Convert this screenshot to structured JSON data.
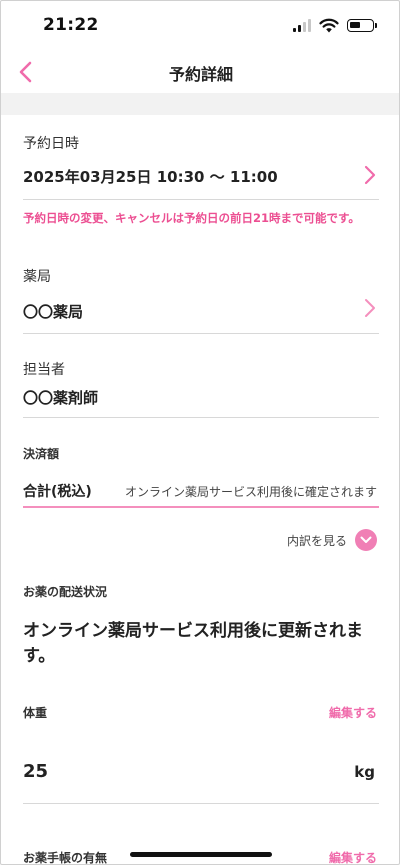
{
  "status_bar": {
    "time": "21:22",
    "icons": [
      "signal-icon",
      "wifi-icon",
      "battery-icon"
    ]
  },
  "header": {
    "title": "予約詳細",
    "back_icon": "chevron-left-icon"
  },
  "reservation": {
    "label": "予約日時",
    "value": "2025年03月25日 10:30 〜 11:00",
    "notice": "予約日時の変更、キャンセルは予約日の前日21時まで可能です。"
  },
  "pharmacy": {
    "label": "薬局",
    "value": "〇〇薬局"
  },
  "pharmacist": {
    "label": "担当者",
    "value": "〇〇薬剤師"
  },
  "payment": {
    "label": "決済額",
    "total_label": "合計(税込)",
    "total_value": "オンライン薬局サービス利用後に確定されます",
    "breakdown_label": "内訳を見る"
  },
  "delivery": {
    "label": "お薬の配送状況",
    "value": "オンライン薬局サービス利用後に更新されます。"
  },
  "weight": {
    "label": "体重",
    "edit_label": "編集する",
    "value": "25",
    "unit": "kg"
  },
  "medication_notebook": {
    "label": "お薬手帳の有無",
    "edit_label": "編集する"
  },
  "colors": {
    "accent": "#f06bab",
    "notice": "#ec4f92",
    "band": "#f2f2f2"
  }
}
